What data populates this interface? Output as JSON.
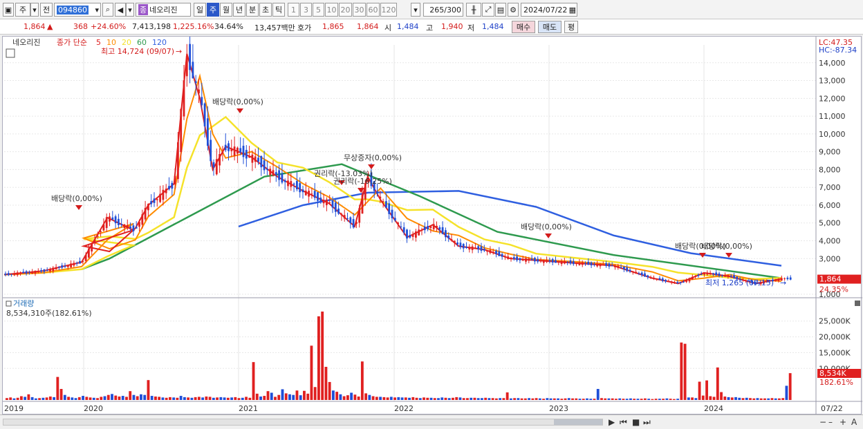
{
  "toolbar": {
    "market": "주",
    "prev": "전",
    "code": "094860",
    "name": "네오리진",
    "tag": "종",
    "periods": [
      "일",
      "주",
      "월",
      "년",
      "분",
      "초",
      "틱"
    ],
    "selected_period": "주",
    "intervals": [
      "1",
      "3",
      "5",
      "10",
      "20",
      "30",
      "60",
      "120"
    ],
    "count": "265",
    "count_max": "/300",
    "date": "2024/07/22"
  },
  "quote": {
    "price": "1,864",
    "change": "368",
    "change_pct": "+24.60%",
    "volume": "7,413,198",
    "volume_pct": "1,225.16%",
    "turnover": "34.64%",
    "amount": "13,457백만",
    "hoga_label": "호가",
    "ask": "1,865",
    "bid": "1,864",
    "open_label": "시",
    "open": "1,484",
    "high_label": "고",
    "high": "1,940",
    "low_label": "저",
    "low": "1,484",
    "buy": "매수",
    "sell": "매도",
    "eval": "평"
  },
  "chart_data": {
    "type": "line",
    "legend": {
      "name": "네오리진",
      "price_label": "종가 단순",
      "ma": [
        "5",
        "10",
        "20",
        "60",
        "120"
      ]
    },
    "colors": {
      "ma5": "#e02020",
      "ma10": "#ff8c00",
      "ma20": "#f5e22a",
      "ma60": "#2e9a4e",
      "ma120": "#2f5fe0",
      "up": "#e02020",
      "down": "#1f4fd8"
    },
    "lc": "LC:47.35",
    "hc": "HC:-87.34",
    "y_ticks": [
      "14,000",
      "13,000",
      "12,000",
      "11,000",
      "10,000",
      "9,000",
      "8,000",
      "7,000",
      "6,000",
      "5,000",
      "4,000",
      "3,000",
      "1,000"
    ],
    "ylim": [
      800,
      15000
    ],
    "x_labels": [
      "2019",
      "2020",
      "2021",
      "2022",
      "2023",
      "2024",
      "07/22"
    ],
    "last_price": "1,864",
    "last_pct": "24.35%",
    "max_label": "최고 14,724 (09/07)",
    "min_label": "최저 1,265 (07/15)",
    "annotations": [
      "배당락(0,00%)",
      "배당락(0,00%)",
      "무상증자(0,00%)",
      "권리락(-13.03%)",
      "권리락(-16.25%)",
      "배당락(0,00%)",
      "배당락(0,00%)",
      "배당락(0,00%)"
    ],
    "series_close": [
      {
        "x": "2019-01",
        "y": 2100
      },
      {
        "x": "2019-04",
        "y": 2300
      },
      {
        "x": "2019-07",
        "y": 2800
      },
      {
        "x": "2019-09",
        "y": 5300
      },
      {
        "x": "2019-11",
        "y": 4600
      },
      {
        "x": "2020-01",
        "y": 3700
      },
      {
        "x": "2020-03",
        "y": 3400
      },
      {
        "x": "2020-05",
        "y": 4700
      },
      {
        "x": "2020-06",
        "y": 6000
      },
      {
        "x": "2020-08",
        "y": 7200
      },
      {
        "x": "2020-09",
        "y": 14500
      },
      {
        "x": "2020-10",
        "y": 12000
      },
      {
        "x": "2020-11",
        "y": 8000
      },
      {
        "x": "2020-12",
        "y": 9300
      },
      {
        "x": "2021-02",
        "y": 8700
      },
      {
        "x": "2021-04",
        "y": 7600
      },
      {
        "x": "2021-06",
        "y": 6800
      },
      {
        "x": "2021-08",
        "y": 6100
      },
      {
        "x": "2021-10",
        "y": 4800
      },
      {
        "x": "2021-11",
        "y": 7600
      },
      {
        "x": "2021-12",
        "y": 6300
      },
      {
        "x": "2022-02",
        "y": 4200
      },
      {
        "x": "2022-04",
        "y": 4900
      },
      {
        "x": "2022-06",
        "y": 3700
      },
      {
        "x": "2022-08",
        "y": 3500
      },
      {
        "x": "2022-10",
        "y": 3000
      },
      {
        "x": "2022-12",
        "y": 2900
      },
      {
        "x": "2023-03",
        "y": 2750
      },
      {
        "x": "2023-06",
        "y": 2600
      },
      {
        "x": "2023-09",
        "y": 1900
      },
      {
        "x": "2023-11",
        "y": 1600
      },
      {
        "x": "2024-01",
        "y": 2200
      },
      {
        "x": "2024-03",
        "y": 2000
      },
      {
        "x": "2024-05",
        "y": 1600
      },
      {
        "x": "2024-07",
        "y": 1864
      }
    ],
    "series_ma120": [
      {
        "x": "2021-01",
        "y": 4800
      },
      {
        "x": "2021-06",
        "y": 6000
      },
      {
        "x": "2021-11",
        "y": 6700
      },
      {
        "x": "2022-06",
        "y": 6800
      },
      {
        "x": "2022-12",
        "y": 5900
      },
      {
        "x": "2023-06",
        "y": 4300
      },
      {
        "x": "2023-12",
        "y": 3300
      },
      {
        "x": "2024-07",
        "y": 2600
      }
    ],
    "series_ma60": [
      {
        "x": "2019-07",
        "y": 2400
      },
      {
        "x": "2020-03",
        "y": 3000
      },
      {
        "x": "2020-09",
        "y": 5300
      },
      {
        "x": "2021-03",
        "y": 7600
      },
      {
        "x": "2021-09",
        "y": 8300
      },
      {
        "x": "2022-03",
        "y": 6500
      },
      {
        "x": "2022-09",
        "y": 4500
      },
      {
        "x": "2023-06",
        "y": 3200
      },
      {
        "x": "2024-07",
        "y": 1900
      }
    ]
  },
  "volume": {
    "title": "거래량",
    "value": "8,534,310주(182.61%)",
    "y_ticks": [
      "25,000K",
      "20,000K",
      "15,000K",
      "10,000K"
    ],
    "last": "8,534K",
    "last_pct": "182.61%",
    "max": 28000,
    "bars": [
      0.6,
      0.8,
      0.5,
      0.7,
      1.2,
      1.0,
      1.8,
      0.9,
      0.5,
      0.6,
      0.7,
      0.8,
      1.1,
      0.9,
      7.3,
      3.5,
      1.6,
      1.0,
      0.8,
      0.6,
      0.9,
      1.3,
      1.0,
      0.8,
      0.7,
      0.6,
      1.0,
      1.2,
      1.6,
      1.9,
      1.4,
      1.1,
      1.3,
      1.0,
      2.8,
      1.6,
      1.2,
      1.8,
      1.6,
      6.3,
      1.3,
      1.1,
      1.0,
      0.8,
      0.7,
      0.9,
      0.8,
      0.7,
      1.3,
      0.9,
      0.8,
      0.7,
      0.9,
      1.0,
      0.8,
      1.1,
      1.0,
      0.7,
      0.8,
      0.9,
      0.8,
      0.7,
      0.8,
      0.9,
      0.6,
      0.7,
      1.0,
      0.7,
      12.0,
      2.0,
      1.1,
      1.3,
      2.8,
      2.3,
      1.0,
      1.6,
      3.4,
      2.1,
      1.8,
      1.6,
      3.0,
      1.5,
      2.9,
      2.0,
      17.2,
      4.1,
      26.5,
      28.0,
      10.5,
      5.7,
      3.0,
      2.6,
      1.8,
      1.2,
      1.5,
      2.3,
      1.7,
      1.1,
      12.2,
      2.1,
      1.6,
      1.2,
      1.0,
      1.0,
      0.9,
      0.8,
      1.0,
      0.8,
      0.9,
      0.8,
      0.8,
      0.7,
      0.9,
      0.7,
      0.6,
      0.8,
      0.7,
      0.7,
      0.6,
      0.6,
      0.8,
      0.7,
      0.6,
      0.7,
      0.9,
      0.8,
      0.6,
      0.6,
      0.7,
      0.7,
      0.6,
      0.6,
      0.7,
      0.6,
      0.6,
      0.5,
      0.6,
      0.6,
      2.4,
      0.5,
      0.6,
      0.6,
      0.5,
      0.5,
      0.6,
      0.5,
      0.6,
      0.5,
      0.4,
      0.6,
      0.5,
      0.5,
      0.5,
      0.4,
      0.5,
      0.6,
      0.5,
      0.5,
      0.4,
      0.4,
      0.5,
      0.4,
      0.4,
      3.5,
      0.6,
      0.5,
      0.5,
      0.5,
      0.4,
      0.5,
      0.4,
      0.4,
      0.5,
      0.4,
      0.4,
      0.4,
      0.5,
      0.4,
      0.3,
      0.4,
      0.4,
      0.4,
      0.5,
      0.4,
      0.3,
      0.4,
      18.2,
      17.8,
      0.8,
      0.8,
      0.6,
      5.8,
      1.4,
      6.2,
      1.2,
      1.0,
      10.3,
      2.5,
      1.1,
      0.9,
      0.8,
      0.9,
      0.7,
      0.6,
      0.7,
      0.6,
      0.5,
      0.6,
      0.5,
      0.5,
      0.5,
      0.6,
      0.5,
      0.5,
      0.6,
      4.5,
      8.5
    ]
  },
  "bottom": {
    "zoom_icons": [
      "◀",
      "◀◀",
      "■",
      "▶▶"
    ]
  }
}
